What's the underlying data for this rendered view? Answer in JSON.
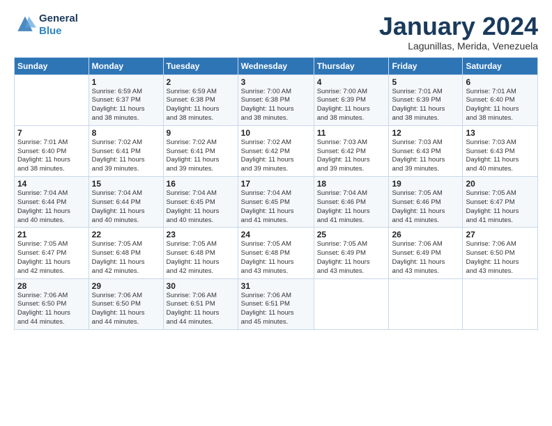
{
  "header": {
    "logo_line1": "General",
    "logo_line2": "Blue",
    "month_title": "January 2024",
    "location": "Lagunillas, Merida, Venezuela"
  },
  "days_of_week": [
    "Sunday",
    "Monday",
    "Tuesday",
    "Wednesday",
    "Thursday",
    "Friday",
    "Saturday"
  ],
  "weeks": [
    [
      {
        "day": "",
        "info": ""
      },
      {
        "day": "1",
        "info": "Sunrise: 6:59 AM\nSunset: 6:37 PM\nDaylight: 11 hours\nand 38 minutes."
      },
      {
        "day": "2",
        "info": "Sunrise: 6:59 AM\nSunset: 6:38 PM\nDaylight: 11 hours\nand 38 minutes."
      },
      {
        "day": "3",
        "info": "Sunrise: 7:00 AM\nSunset: 6:38 PM\nDaylight: 11 hours\nand 38 minutes."
      },
      {
        "day": "4",
        "info": "Sunrise: 7:00 AM\nSunset: 6:39 PM\nDaylight: 11 hours\nand 38 minutes."
      },
      {
        "day": "5",
        "info": "Sunrise: 7:01 AM\nSunset: 6:39 PM\nDaylight: 11 hours\nand 38 minutes."
      },
      {
        "day": "6",
        "info": "Sunrise: 7:01 AM\nSunset: 6:40 PM\nDaylight: 11 hours\nand 38 minutes."
      }
    ],
    [
      {
        "day": "7",
        "info": "Sunrise: 7:01 AM\nSunset: 6:40 PM\nDaylight: 11 hours\nand 38 minutes."
      },
      {
        "day": "8",
        "info": "Sunrise: 7:02 AM\nSunset: 6:41 PM\nDaylight: 11 hours\nand 39 minutes."
      },
      {
        "day": "9",
        "info": "Sunrise: 7:02 AM\nSunset: 6:41 PM\nDaylight: 11 hours\nand 39 minutes."
      },
      {
        "day": "10",
        "info": "Sunrise: 7:02 AM\nSunset: 6:42 PM\nDaylight: 11 hours\nand 39 minutes."
      },
      {
        "day": "11",
        "info": "Sunrise: 7:03 AM\nSunset: 6:42 PM\nDaylight: 11 hours\nand 39 minutes."
      },
      {
        "day": "12",
        "info": "Sunrise: 7:03 AM\nSunset: 6:43 PM\nDaylight: 11 hours\nand 39 minutes."
      },
      {
        "day": "13",
        "info": "Sunrise: 7:03 AM\nSunset: 6:43 PM\nDaylight: 11 hours\nand 40 minutes."
      }
    ],
    [
      {
        "day": "14",
        "info": "Sunrise: 7:04 AM\nSunset: 6:44 PM\nDaylight: 11 hours\nand 40 minutes."
      },
      {
        "day": "15",
        "info": "Sunrise: 7:04 AM\nSunset: 6:44 PM\nDaylight: 11 hours\nand 40 minutes."
      },
      {
        "day": "16",
        "info": "Sunrise: 7:04 AM\nSunset: 6:45 PM\nDaylight: 11 hours\nand 40 minutes."
      },
      {
        "day": "17",
        "info": "Sunrise: 7:04 AM\nSunset: 6:45 PM\nDaylight: 11 hours\nand 41 minutes."
      },
      {
        "day": "18",
        "info": "Sunrise: 7:04 AM\nSunset: 6:46 PM\nDaylight: 11 hours\nand 41 minutes."
      },
      {
        "day": "19",
        "info": "Sunrise: 7:05 AM\nSunset: 6:46 PM\nDaylight: 11 hours\nand 41 minutes."
      },
      {
        "day": "20",
        "info": "Sunrise: 7:05 AM\nSunset: 6:47 PM\nDaylight: 11 hours\nand 41 minutes."
      }
    ],
    [
      {
        "day": "21",
        "info": "Sunrise: 7:05 AM\nSunset: 6:47 PM\nDaylight: 11 hours\nand 42 minutes."
      },
      {
        "day": "22",
        "info": "Sunrise: 7:05 AM\nSunset: 6:48 PM\nDaylight: 11 hours\nand 42 minutes."
      },
      {
        "day": "23",
        "info": "Sunrise: 7:05 AM\nSunset: 6:48 PM\nDaylight: 11 hours\nand 42 minutes."
      },
      {
        "day": "24",
        "info": "Sunrise: 7:05 AM\nSunset: 6:48 PM\nDaylight: 11 hours\nand 43 minutes."
      },
      {
        "day": "25",
        "info": "Sunrise: 7:05 AM\nSunset: 6:49 PM\nDaylight: 11 hours\nand 43 minutes."
      },
      {
        "day": "26",
        "info": "Sunrise: 7:06 AM\nSunset: 6:49 PM\nDaylight: 11 hours\nand 43 minutes."
      },
      {
        "day": "27",
        "info": "Sunrise: 7:06 AM\nSunset: 6:50 PM\nDaylight: 11 hours\nand 43 minutes."
      }
    ],
    [
      {
        "day": "28",
        "info": "Sunrise: 7:06 AM\nSunset: 6:50 PM\nDaylight: 11 hours\nand 44 minutes."
      },
      {
        "day": "29",
        "info": "Sunrise: 7:06 AM\nSunset: 6:50 PM\nDaylight: 11 hours\nand 44 minutes."
      },
      {
        "day": "30",
        "info": "Sunrise: 7:06 AM\nSunset: 6:51 PM\nDaylight: 11 hours\nand 44 minutes."
      },
      {
        "day": "31",
        "info": "Sunrise: 7:06 AM\nSunset: 6:51 PM\nDaylight: 11 hours\nand 45 minutes."
      },
      {
        "day": "",
        "info": ""
      },
      {
        "day": "",
        "info": ""
      },
      {
        "day": "",
        "info": ""
      }
    ]
  ]
}
